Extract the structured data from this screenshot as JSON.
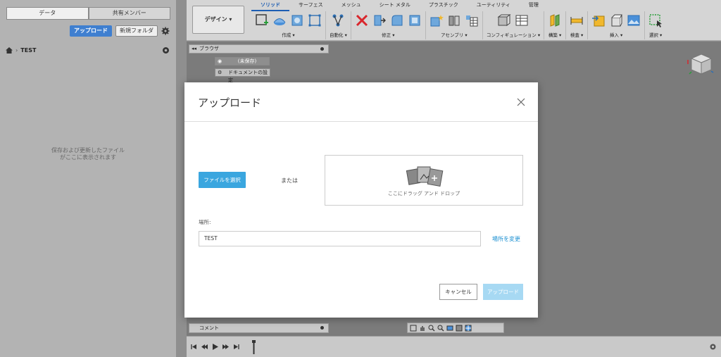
{
  "data_panel": {
    "tabs": [
      "データ",
      "共有メンバー"
    ],
    "upload_label": "アップロード",
    "new_folder_label": "新規フォルダ",
    "breadcrumb": "TEST",
    "empty_message_line1": "保存および更新したファイル",
    "empty_message_line2": "がここに表示されます"
  },
  "toolbar": {
    "design_label": "デザイン ▾",
    "tabs": [
      "ソリッド",
      "サーフェス",
      "メッシュ",
      "シート メタル",
      "プラスチック",
      "ユーティリティ",
      "管理"
    ],
    "groups": [
      "作成 ▾",
      "自動化 ▾",
      "修正 ▾",
      "アセンブリ ▾",
      "コンフィギュレーション ▾",
      "構築 ▾",
      "検査 ▾",
      "挿入 ▾",
      "選択 ▾"
    ]
  },
  "canvas": {
    "browser_label": "ブラウザ",
    "tree_root": "(未保存)",
    "tree_doc_settings": "ドキュメントの設定",
    "comment_label": "コメント"
  },
  "modal": {
    "title": "アップロード",
    "choose_file_label": "ファイルを選択",
    "or_label": "または",
    "drop_text": "ここにドラッグ アンド ドロップ",
    "location_label": "場所:",
    "location_value": "TEST",
    "change_location_label": "場所を変更",
    "cancel_label": "キャンセル",
    "upload_label": "アップロード"
  },
  "colors": {
    "accent": "#3aa6df",
    "link": "#1a8fd1",
    "primary_disabled": "#a7d9f3",
    "upload_blue": "#3f7fd0"
  }
}
